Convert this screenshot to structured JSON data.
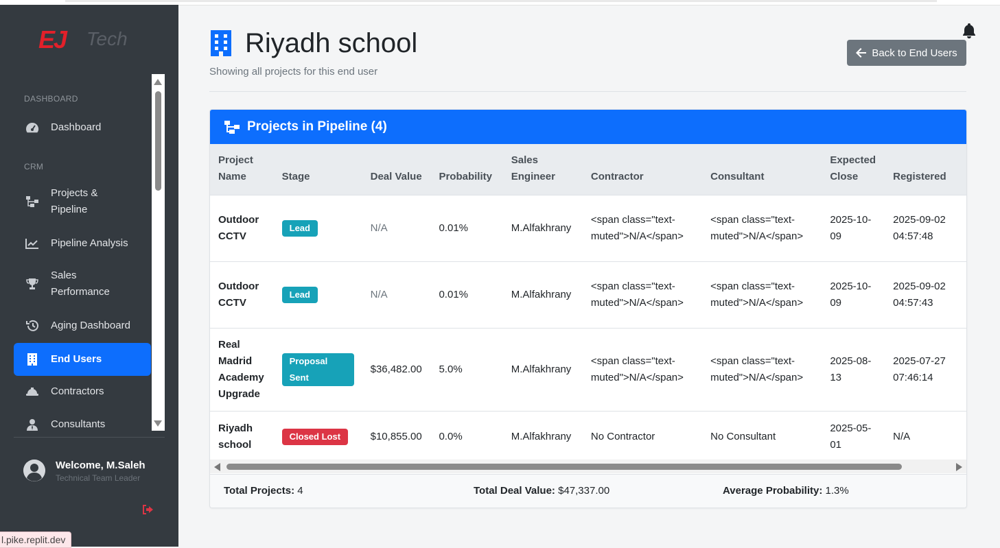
{
  "brand": {
    "logo_primary": "EJ",
    "logo_secondary": "Tech"
  },
  "sidebar": {
    "sections": [
      {
        "label": "DASHBOARD"
      },
      {
        "label": "CRM"
      }
    ],
    "items": [
      {
        "label": "Dashboard",
        "icon": "tachometer-icon"
      },
      {
        "label": "Projects & Pipeline",
        "icon": "sitemap-icon"
      },
      {
        "label": "Pipeline Analysis",
        "icon": "chart-line-icon"
      },
      {
        "label": "Sales Performance",
        "icon": "trophy-icon"
      },
      {
        "label": "Aging Dashboard",
        "icon": "history-icon"
      },
      {
        "label": "End Users",
        "icon": "building-icon",
        "active": true
      },
      {
        "label": "Contractors",
        "icon": "hard-hat-icon"
      },
      {
        "label": "Consultants",
        "icon": "user-tie-icon"
      }
    ],
    "user": {
      "welcome": "Welcome, M.Saleh",
      "role": "Technical Team Leader"
    }
  },
  "status_url": "l.pike.replit.dev",
  "header": {
    "title": "Riyadh school",
    "subtitle": "Showing all projects for this end user",
    "back_button": "Back to End Users"
  },
  "card": {
    "title": "Projects in Pipeline (4)",
    "columns": [
      "Project Name",
      "Stage",
      "Deal Value",
      "Probability",
      "Sales Engineer",
      "Contractor",
      "Consultant",
      "Expected Close",
      "Registered"
    ],
    "rows": [
      {
        "name": "Outdoor CCTV",
        "stage": "Lead",
        "value": "N/A",
        "probability": "0.01%",
        "engineer": "M.Alfakhrany",
        "contractor": "<span class=\"text-muted\">N/A</span>",
        "consultant": "<span class=\"text-muted\">N/A</span>",
        "close": "2025-10-09",
        "registered": "2025-09-02 04:57:48"
      },
      {
        "name": "Outdoor CCTV",
        "stage": "Lead",
        "value": "N/A",
        "probability": "0.01%",
        "engineer": "M.Alfakhrany",
        "contractor": "<span class=\"text-muted\">N/A</span>",
        "consultant": "<span class=\"text-muted\">N/A</span>",
        "close": "2025-10-09",
        "registered": "2025-09-02 04:57:43"
      },
      {
        "name": "Real Madrid Academy Upgrade",
        "stage": "Proposal Sent",
        "value": "$36,482.00",
        "probability": "5.0%",
        "engineer": "M.Alfakhrany",
        "contractor": "<span class=\"text-muted\">N/A</span>",
        "consultant": "<span class=\"text-muted\">N/A</span>",
        "close": "2025-08-13",
        "registered": "2025-07-27 07:46:14"
      },
      {
        "name": "Riyadh school",
        "stage": "Closed Lost",
        "value": "$10,855.00",
        "probability": "0.0%",
        "engineer": "M.Alfakhrany",
        "contractor": "No Contractor",
        "consultant": "No Consultant",
        "close": "2025-05-01",
        "registered": "N/A"
      }
    ],
    "footer": {
      "total_projects_label": "Total Projects:",
      "total_projects": "4",
      "total_value_label": "Total Deal Value:",
      "total_value": "$47,337.00",
      "avg_prob_label": "Average Probability:",
      "avg_prob": "1.3%"
    }
  },
  "colors": {
    "primary": "#0d6efd",
    "sidebar": "#343a40",
    "badge_info": "#17a2b8",
    "badge_danger": "#dc3545",
    "brand_red": "#e3202a"
  }
}
